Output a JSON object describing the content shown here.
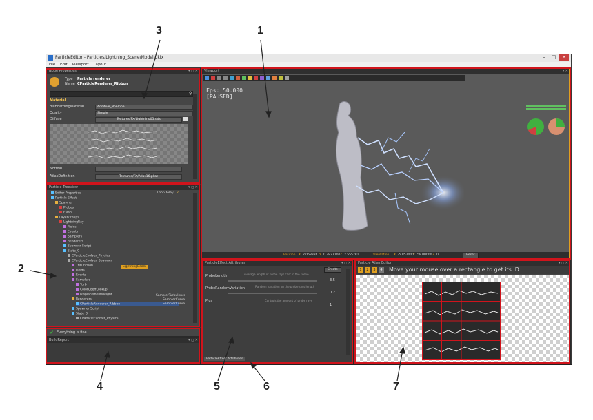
{
  "window": {
    "title": "ParticleEditor - Particles/Lightning_Scene/Model.pkfx",
    "controls": [
      "–",
      "□",
      "✕"
    ]
  },
  "menu": [
    "File",
    "Edit",
    "Viewport",
    "Layout"
  ],
  "node_properties": {
    "header": "Node Properties",
    "type_label": "Type",
    "type_value": "Particle renderer",
    "name_label": "Name",
    "name_value": "CParticleRenderer_Ribbon",
    "section": "Material",
    "fields": [
      {
        "label": "BillboardingMaterial",
        "value": "Additive_NoAlpha"
      },
      {
        "label": "Quality",
        "value": "Simple"
      },
      {
        "label": "Diffuse",
        "value": "Textures/FX/Lightning05.dds"
      }
    ],
    "normal_label": "Normal",
    "atlas_label": "AtlasDefinition",
    "atlas_value": "Textures/FX/Atlas16.pkat"
  },
  "treeview": {
    "header": "Particle Treeview",
    "loop_delay_label": "LoopDelay",
    "loop_delay_value": "2",
    "items": [
      {
        "label": "Editor Properties",
        "depth": 0,
        "color": "#58c0ff"
      },
      {
        "label": "Particle Effect",
        "depth": 0,
        "color": "#58c0ff"
      },
      {
        "label": "Spawner",
        "depth": 1,
        "color": "#e6b040"
      },
      {
        "label": "Probes",
        "depth": 2,
        "color": "#d84040"
      },
      {
        "label": "Flash",
        "depth": 2,
        "color": "#d84040"
      },
      {
        "label": "LayerGroups",
        "depth": 1,
        "color": "#e6b040"
      },
      {
        "label": "LightningRay",
        "depth": 2,
        "color": "#d84040"
      },
      {
        "label": "Fields",
        "depth": 3,
        "color": "#c070e0"
      },
      {
        "label": "Events",
        "depth": 3,
        "color": "#c070e0"
      },
      {
        "label": "Samplers",
        "depth": 3,
        "color": "#c070e0"
      },
      {
        "label": "Renderers",
        "depth": 3,
        "color": "#c070e0"
      },
      {
        "label": "Spawner Script",
        "depth": 3,
        "color": "#58c0ff"
      },
      {
        "label": "State_0",
        "depth": 3,
        "color": "#58c0ff"
      },
      {
        "label": "CParticleEvolver_Physics",
        "depth": 4,
        "color": "#aaaaaa"
      },
      {
        "label": "CParticleEvolver_Spawner",
        "depth": 4,
        "color": "#aaaaaa"
      },
      {
        "label": "TtlFunction",
        "depth": 5,
        "color": "#c070e0"
      },
      {
        "label": "Fields",
        "depth": 5,
        "color": "#c070e0"
      },
      {
        "label": "Events",
        "depth": 5,
        "color": "#c070e0"
      },
      {
        "label": "Samplers",
        "depth": 5,
        "color": "#c070e0"
      },
      {
        "label": "Turb",
        "depth": 6,
        "color": "#c070e0"
      },
      {
        "label": "ColorCoeffLookup",
        "depth": 6,
        "color": "#c070e0"
      },
      {
        "label": "DisplacementWeight",
        "depth": 6,
        "color": "#c070e0"
      },
      {
        "label": "Renderers",
        "depth": 5,
        "color": "#e6b040"
      },
      {
        "label": "CParticleRenderer_Ribbon",
        "depth": 6,
        "color": "#58c0ff"
      },
      {
        "label": "Spawner Script",
        "depth": 5,
        "color": "#58c0ff"
      },
      {
        "label": "State_0",
        "depth": 5,
        "color": "#58c0ff"
      },
      {
        "label": "CParticleEvolver_Physics",
        "depth": 6,
        "color": "#aaaaaa"
      }
    ],
    "spawner_tag": "LightningBeam",
    "sampler_types": [
      "SamplerTurbulence",
      "SamplerCurve",
      "SamplerCurve"
    ]
  },
  "status": {
    "message": "Everything is fine"
  },
  "buildreport": {
    "header": "BuildReport"
  },
  "viewport": {
    "tab": "Viewport",
    "fps": "Fps: 50.000",
    "paused": "[PAUSED]",
    "position_label": "Position",
    "position": [
      "2.068384",
      "0.7827100",
      "2.555281"
    ],
    "orientation_label": "Orientation",
    "orientation": [
      "-5.852000",
      "59.00000",
      "0"
    ],
    "axis_labels": [
      "X",
      "Y",
      "Z"
    ],
    "reset_label": "Reset"
  },
  "attributes": {
    "header": "ParticleEffect Attributes",
    "create_label": "Create",
    "rows": [
      {
        "label": "ProbeLength",
        "desc": "Average length of probe rays cast in the scene",
        "value": "3.5"
      },
      {
        "label": "ProbeRandomVariation",
        "desc": "Random variation on the probe rays length",
        "value": "0.2"
      },
      {
        "label": "Plus",
        "desc": "Controls the amount of probe rays",
        "value": "1"
      }
    ],
    "footer_tab": "ParticleEffect Attributes"
  },
  "atlas_editor": {
    "header": "Particle Atlas Editor",
    "hint": "Move your mouse over a rectangle to get its ID",
    "buttons": [
      "1",
      "2",
      "3",
      "4"
    ]
  },
  "callouts": [
    "1",
    "2",
    "3",
    "4",
    "5",
    "6",
    "7"
  ],
  "colors": {
    "highlight": "#d0141c",
    "accent": "#e6a020",
    "lightning": "#a8c8ff"
  }
}
